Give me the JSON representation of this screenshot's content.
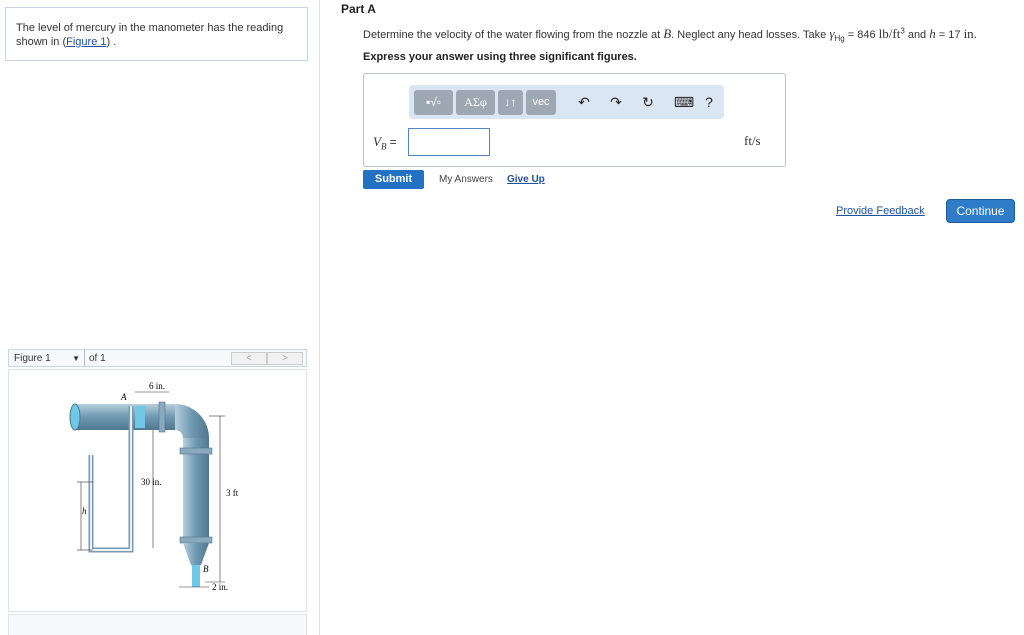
{
  "problem": {
    "text_before": "The level of mercury in the manometer has the reading shown in (",
    "figure_link": "Figure 1",
    "text_after": ") ."
  },
  "figure_nav": {
    "selected": "Figure 1",
    "of_text": "of 1",
    "prev_symbol": "<",
    "next_symbol": ">"
  },
  "figure": {
    "label_6in": "6 in.",
    "label_A": "A",
    "label_30in": "30 in.",
    "label_3ft": "3 ft",
    "label_h": "h",
    "label_B": "B",
    "label_2in": "2 in."
  },
  "part": {
    "title": "Part A",
    "q_lead": "Determine the velocity of the water flowing from the nozzle at ",
    "q_B": "B",
    "q_mid": ". Neglect any head losses. Take ",
    "q_gamma": "γ",
    "q_gamma_sub": "Hg",
    "q_eq": " = 846 ",
    "q_unit": "lb/ft",
    "q_unit_sup": "3",
    "q_and": " and ",
    "q_h": "h",
    "q_h_val": " = 17 ",
    "q_in": "in.",
    "instruction": "Express your answer using three significant figures."
  },
  "toolbar": {
    "templates": "▪√▫",
    "greek": "ΑΣφ",
    "arrows": "↓↑",
    "vec": "vec",
    "undo": "↶",
    "redo": "↷",
    "reset": "↻",
    "keyboard": "⌨",
    "help": "?"
  },
  "answer": {
    "var": "V",
    "var_sub": "B",
    "equals": " =",
    "value": "",
    "unit": "ft/s"
  },
  "actions": {
    "submit": "Submit",
    "my_answers": "My Answers",
    "give_up": "Give Up",
    "feedback": "Provide Feedback",
    "continue": "Continue"
  },
  "colors": {
    "accent": "#2271c2",
    "link": "#1e50a0",
    "pipe": "#7ea6bf",
    "water": "#6fc8e6"
  }
}
